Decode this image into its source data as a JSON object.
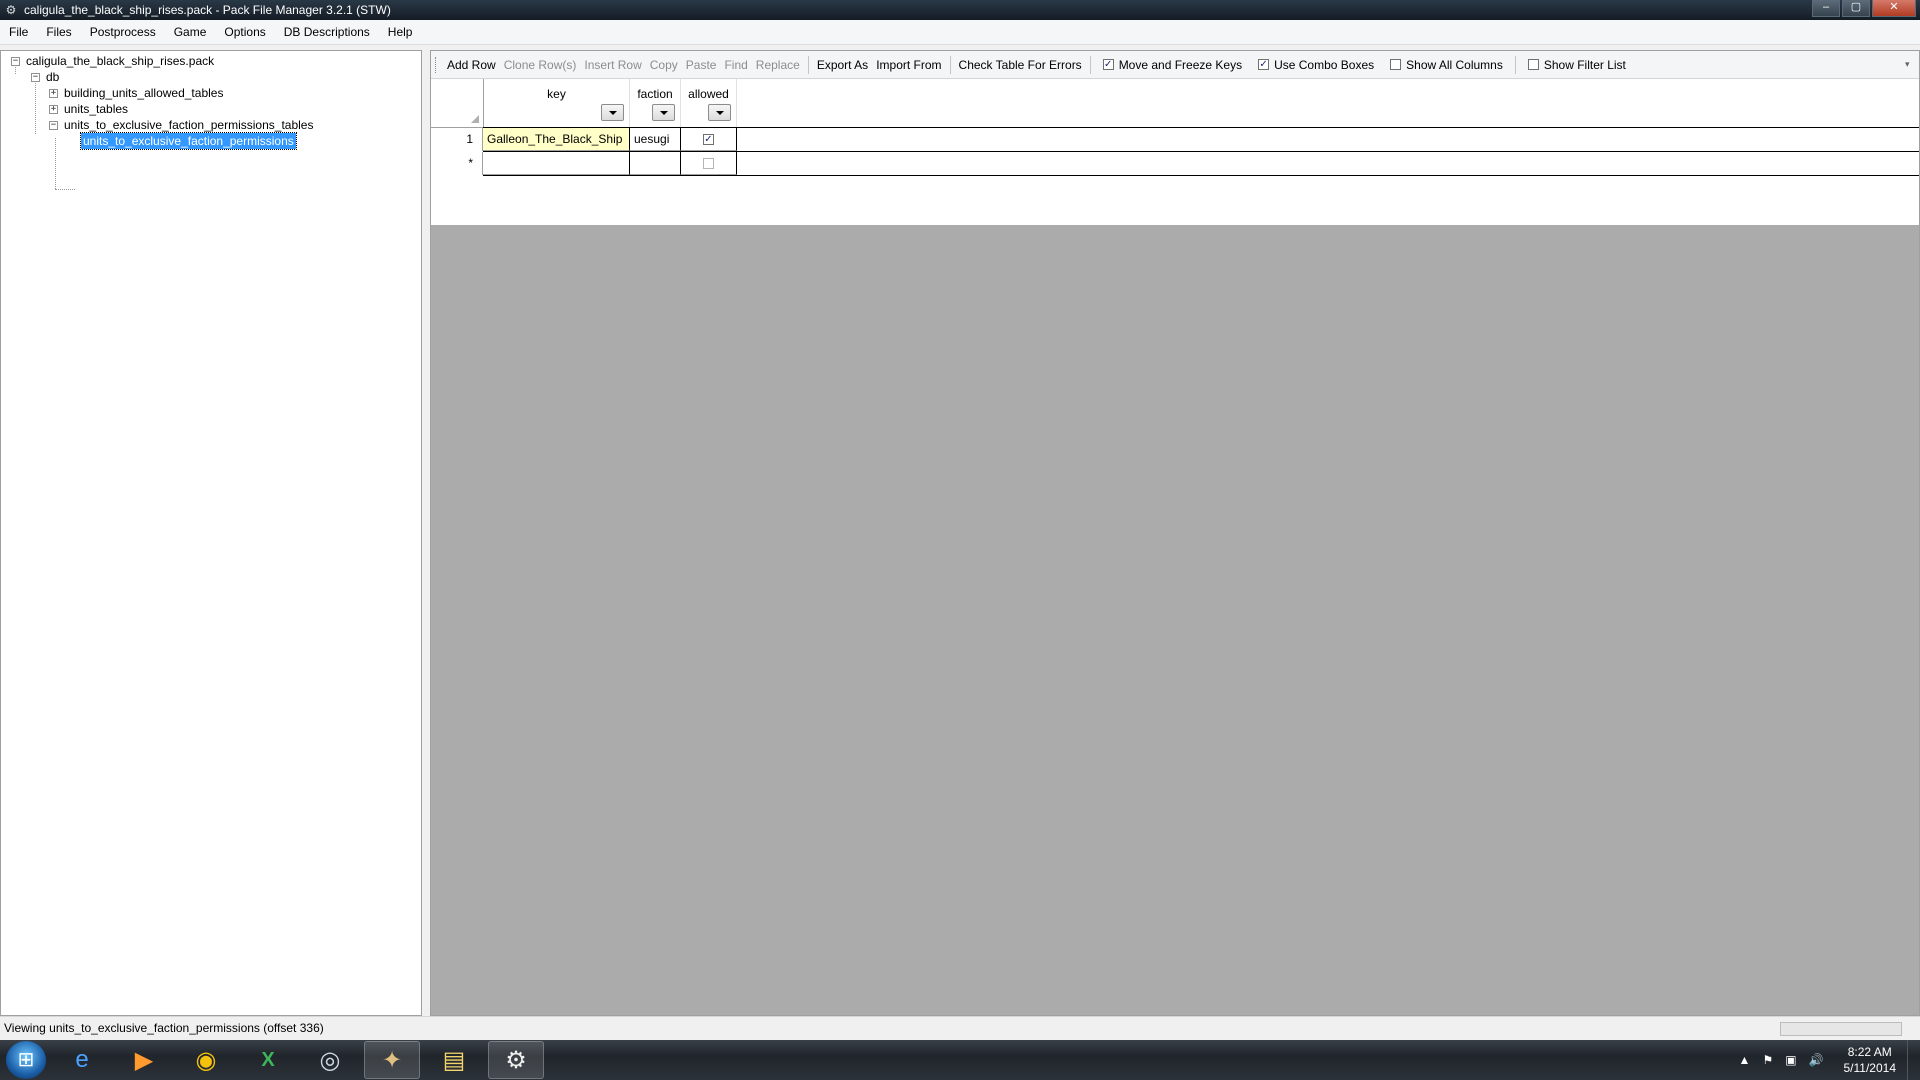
{
  "window": {
    "title": "caligula_the_black_ship_rises.pack - Pack File Manager 3.2.1 (STW)",
    "app_icon": "gear-icon",
    "controls": [
      "minimize",
      "maximize",
      "close"
    ]
  },
  "menu": [
    "File",
    "Files",
    "Postprocess",
    "Game",
    "Options",
    "DB Descriptions",
    "Help"
  ],
  "tree": {
    "root": "caligula_the_black_ship_rises.pack",
    "db": "db",
    "items": [
      {
        "label": "building_units_allowed_tables",
        "expander": "+"
      },
      {
        "label": "units_tables",
        "expander": "+"
      },
      {
        "label": "units_to_exclusive_faction_permissions_tables",
        "expander": "−"
      }
    ],
    "selected": "units_to_exclusive_faction_permissions"
  },
  "toolbar": {
    "buttons": [
      {
        "label": "Add Row",
        "enabled": true
      },
      {
        "label": "Clone Row(s)",
        "enabled": false
      },
      {
        "label": "Insert Row",
        "enabled": false
      },
      {
        "label": "Copy",
        "enabled": false
      },
      {
        "label": "Paste",
        "enabled": false
      },
      {
        "label": "Find",
        "enabled": false
      },
      {
        "label": "Replace",
        "enabled": false
      },
      {
        "label": "Export As",
        "enabled": true
      },
      {
        "label": "Import From",
        "enabled": true
      },
      {
        "label": "Check Table For Errors",
        "enabled": true
      }
    ],
    "checks": [
      {
        "label": "Move and Freeze Keys",
        "checked": true
      },
      {
        "label": "Use Combo Boxes",
        "checked": true
      },
      {
        "label": "Show All Columns",
        "checked": false
      },
      {
        "label": "Show Filter List",
        "checked": false
      }
    ]
  },
  "table": {
    "columns": [
      "key",
      "faction",
      "allowed"
    ],
    "rows": [
      {
        "num": "1",
        "key": "Galleon_The_Black_Ship",
        "faction": "uesugi",
        "allowed": true
      }
    ],
    "new_row_marker": "*"
  },
  "status": {
    "text": "Viewing units_to_exclusive_faction_permissions (offset 336)"
  },
  "taskbar": {
    "icons": [
      "windows-start-icon",
      "internet-explorer-icon",
      "media-player-icon",
      "chrome-icon",
      "excel-icon",
      "steam-icon",
      "pack-manager-icon",
      "file-explorer-icon",
      "gear-app-icon"
    ],
    "time": "8:22 AM",
    "date": "5/11/2014"
  }
}
